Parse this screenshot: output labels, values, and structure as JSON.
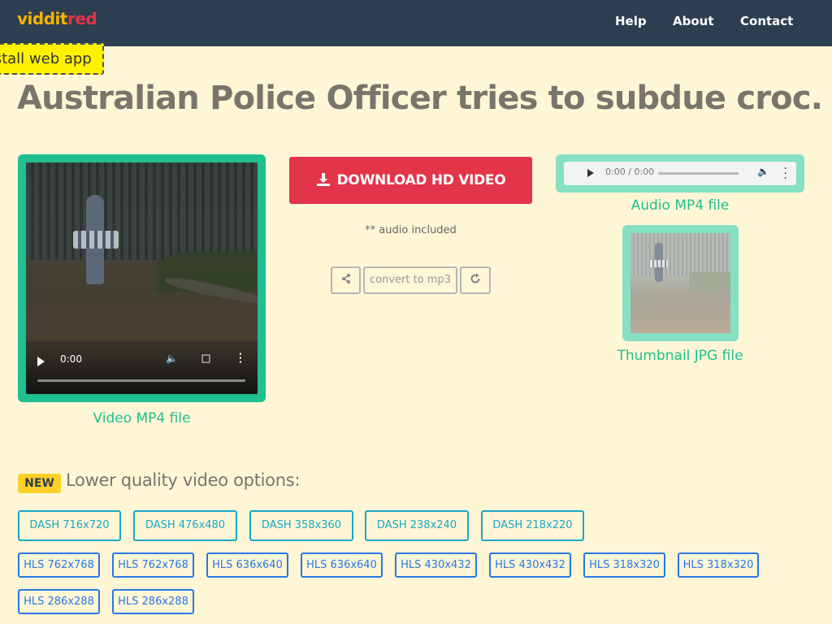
{
  "header": {
    "logo_part1": "viddit",
    "logo_part2": "red",
    "nav": [
      "Help",
      "About",
      "Contact"
    ],
    "install_label": "Install web app"
  },
  "title": "Australian Police Officer tries to subdue croc...",
  "video": {
    "time": "0:00",
    "caption": "Video MP4 file"
  },
  "download": {
    "label": "DOWNLOAD HD VIDEO",
    "audio_note": "** audio included",
    "convert_label": "convert to mp3"
  },
  "audio": {
    "time": "0:00 / 0:00",
    "caption": "Audio MP4 file"
  },
  "thumbnail": {
    "caption": "Thumbnail JPG file"
  },
  "options": {
    "badge": "NEW",
    "title": "Lower quality video options:",
    "dash": [
      "DASH 716x720",
      "DASH 476x480",
      "DASH 358x360",
      "DASH 238x240",
      "DASH 218x220"
    ],
    "hls": [
      "HLS 762x768",
      "HLS 762x768",
      "HLS 636x640",
      "HLS 636x640",
      "HLS 430x432",
      "HLS 430x432",
      "HLS 318x320",
      "HLS 318x320",
      "HLS 286x288",
      "HLS 286x288"
    ]
  },
  "colors": {
    "navbar": "#2d3e50",
    "background": "#fff6d6",
    "accent_green": "#1fbf8f",
    "download_red": "#e3344a",
    "dash_blue": "#1aa6c4",
    "hls_blue": "#2678e6"
  },
  "icons": [
    "download-icon",
    "share-icon",
    "refresh-icon",
    "play-icon",
    "volume-icon",
    "fullscreen-icon",
    "more-icon"
  ]
}
